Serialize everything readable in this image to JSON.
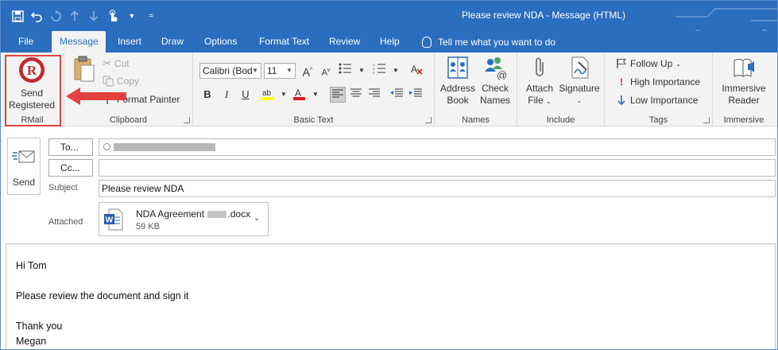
{
  "window": {
    "title": "Please review NDA  -  Message (HTML)"
  },
  "tabs": [
    {
      "label": "File"
    },
    {
      "label": "Message"
    },
    {
      "label": "Insert"
    },
    {
      "label": "Draw"
    },
    {
      "label": "Options"
    },
    {
      "label": "Format Text"
    },
    {
      "label": "Review"
    },
    {
      "label": "Help"
    }
  ],
  "tell_me": "Tell me what you want to do",
  "ribbon": {
    "rmail": {
      "send_label_1": "Send",
      "send_label_2": "Registered",
      "group": "RMail"
    },
    "clipboard": {
      "cut": "Cut",
      "copy": "Copy",
      "format_painter": "Format Painter",
      "group": "Clipboard"
    },
    "basic_text": {
      "font": "Calibri (Bod",
      "size": "11",
      "group": "Basic Text"
    },
    "names": {
      "address_book_1": "Address",
      "address_book_2": "Book",
      "check_names_1": "Check",
      "check_names_2": "Names",
      "group": "Names"
    },
    "include": {
      "attach_1": "Attach",
      "attach_2": "File",
      "signature": "Signature",
      "group": "Include"
    },
    "tags": {
      "follow_up": "Follow Up",
      "high_importance": "High Importance",
      "low_importance": "Low Importance",
      "group": "Tags"
    },
    "immersive": {
      "reader_1": "Immersive",
      "reader_2": "Reader",
      "group": "Immersive"
    }
  },
  "message": {
    "send_label": "Send",
    "to_label": "To...",
    "cc_label": "Cc...",
    "subject_label": "Subject",
    "subject": "Please review NDA",
    "attached_label": "Attached",
    "attachment": {
      "name_start": "NDA Agreement ",
      "name_end": ".docx",
      "size": "59 KB"
    }
  },
  "body": {
    "lines": [
      "Hi Tom",
      "Please review the document and sign it",
      "Thank you",
      "Megan"
    ]
  },
  "colors": {
    "titlebar": "#2b6dbf",
    "ribbon": "#f3f3f3",
    "highlight": "#e2423f",
    "rmail_red": "#c5282f"
  }
}
